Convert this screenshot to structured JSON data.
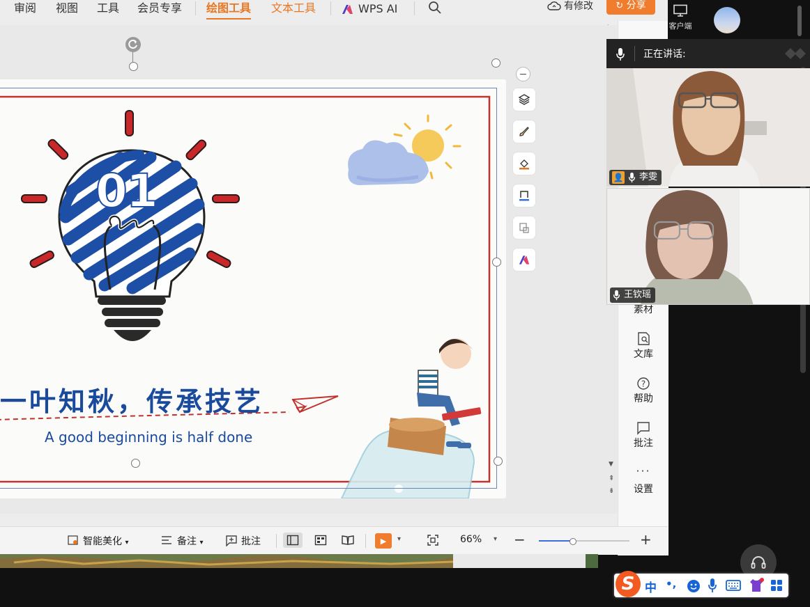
{
  "ribbon": {
    "tabs": [
      "审阅",
      "视图",
      "工具",
      "会员专享",
      "绘图工具",
      "文本工具",
      "WPS AI"
    ],
    "active_tab": "绘图工具",
    "modified": "有修改",
    "share": "分享"
  },
  "slide": {
    "number": "01",
    "title": "一叶知秋，传承技艺",
    "subtitle": "A good beginning is half done"
  },
  "floating_toolbar": {
    "items": [
      "minus-icon",
      "layers-icon",
      "brush-icon",
      "fill-icon",
      "border-icon",
      "shape-icon",
      "wps-ai-icon"
    ]
  },
  "task_pane": {
    "items": [
      {
        "label": "素材",
        "icon": "material-icon"
      },
      {
        "label": "文库",
        "icon": "library-icon"
      },
      {
        "label": "帮助",
        "icon": "help-icon"
      },
      {
        "label": "批注",
        "icon": "comment-icon"
      },
      {
        "label": "设置",
        "icon": "more-icon"
      }
    ]
  },
  "status_bar": {
    "beautify": "智能美化",
    "notes": "备注",
    "comment": "批注",
    "zoom": "66%",
    "zoom_level": 0.37
  },
  "meeting": {
    "client": "客户端",
    "speaking": "正在讲话:",
    "participants": [
      {
        "name": "李雯",
        "host": true
      },
      {
        "name": "王钦瑶",
        "host": false
      }
    ]
  },
  "ime": {
    "lang": "中",
    "punct": "•,"
  },
  "colors": {
    "accent": "#e87722",
    "share": "#f07c2d",
    "slide_title": "#1a4a9c",
    "slide_frame": "#c0322d",
    "selection": "#6c84b8"
  }
}
